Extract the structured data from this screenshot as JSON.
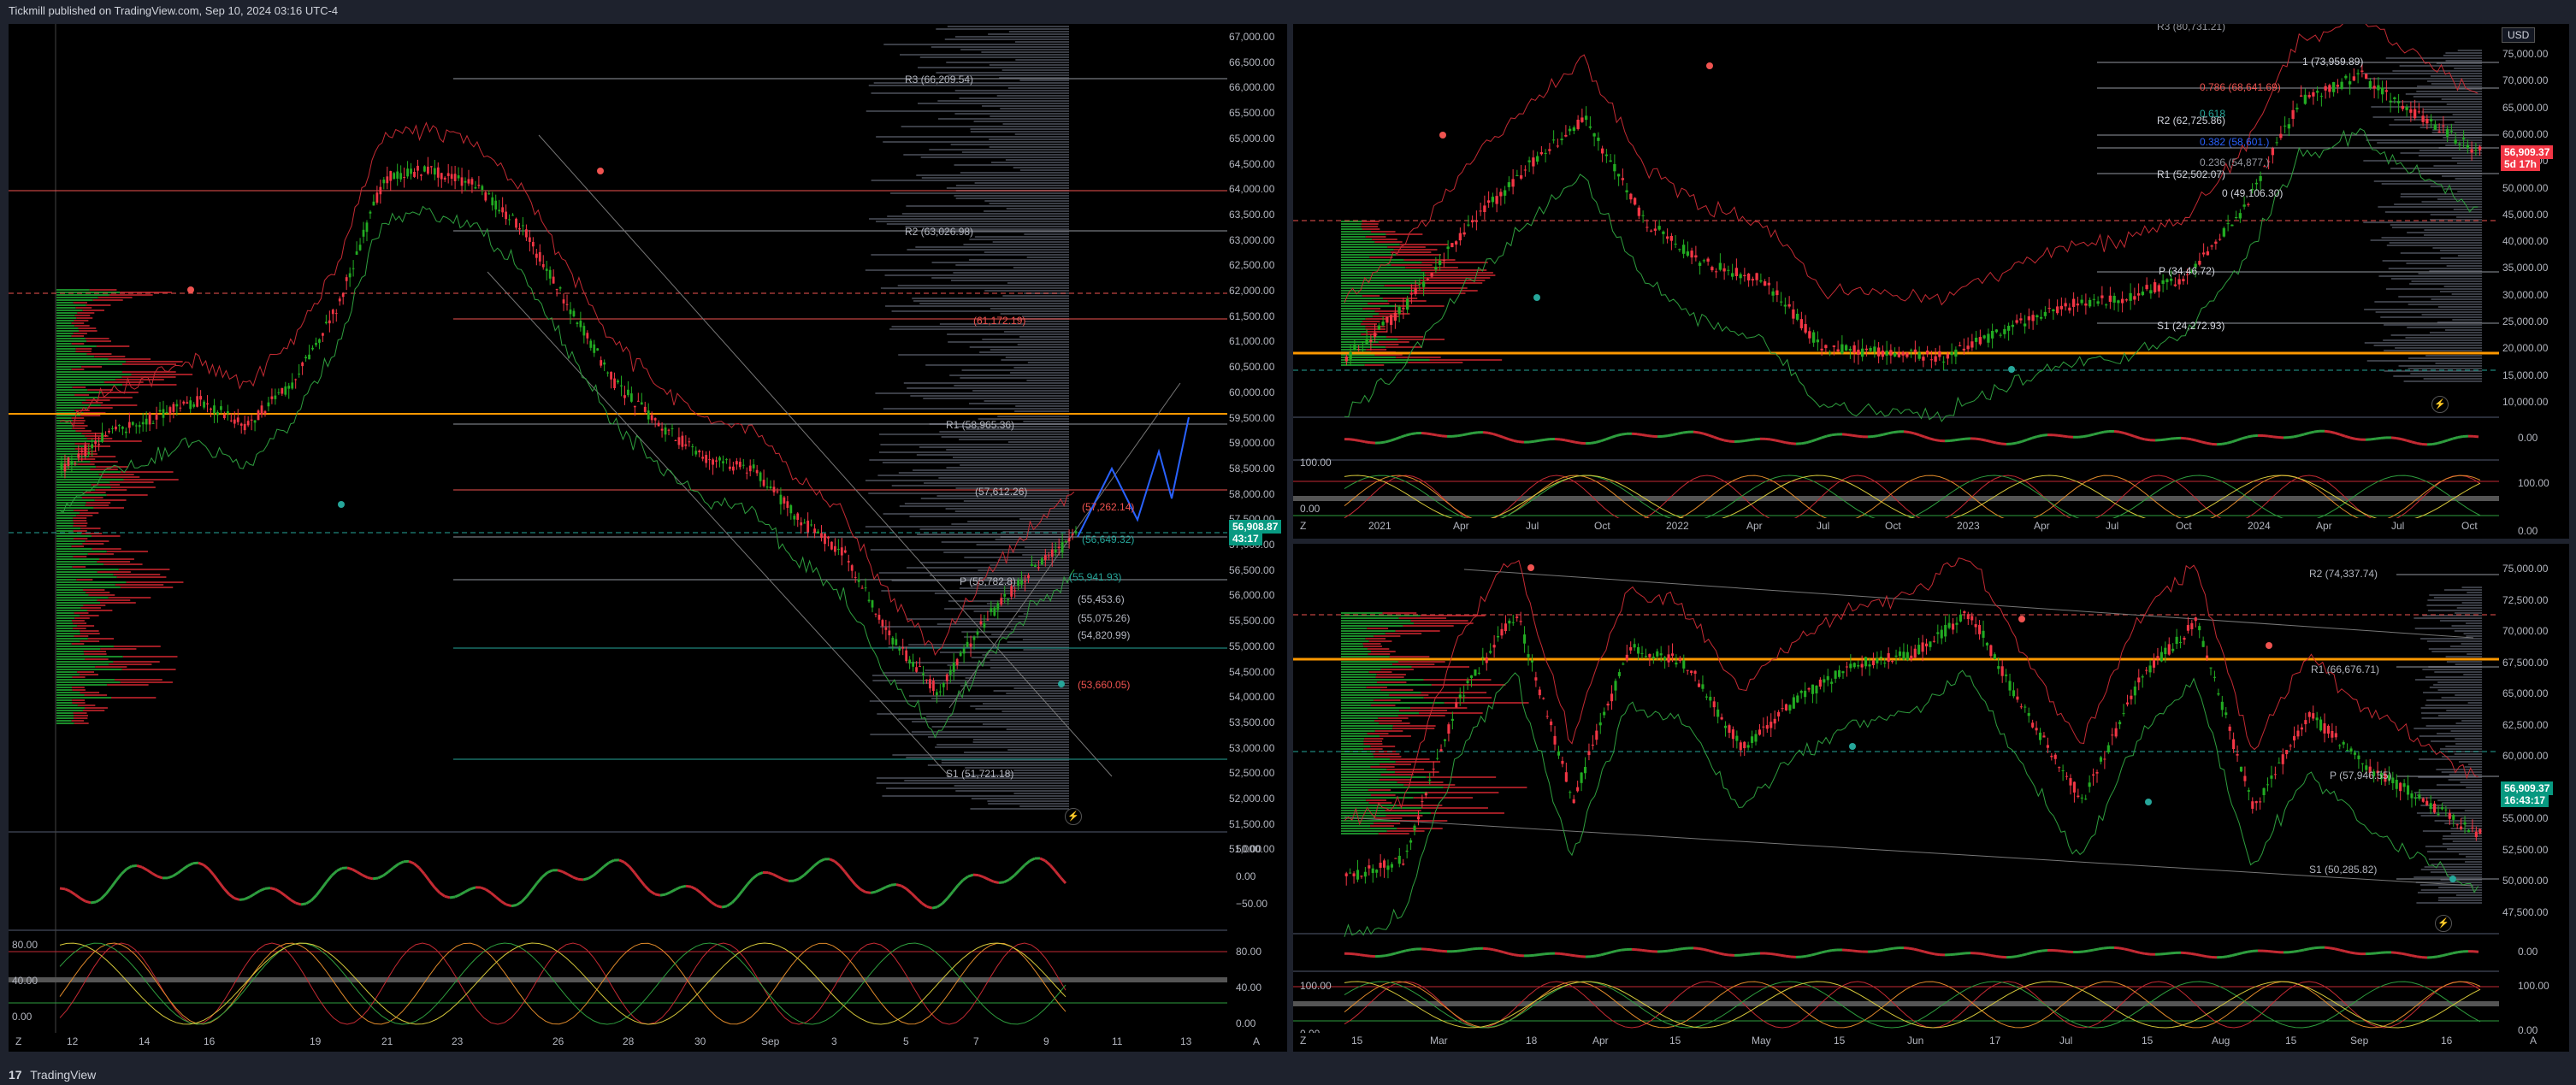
{
  "header": {
    "publisher_text": "Tickmill published on TradingView.com, Sep 10, 2024 03:16 UTC-4"
  },
  "footer": {
    "brand": "TradingView",
    "logo_glyph": "17"
  },
  "colors": {
    "bull": "#26a69a",
    "bear": "#ef5350",
    "green_candle": "#22ab22",
    "red_candle": "#f23645",
    "orange": "#ff9800"
  },
  "left_chart": {
    "price_axis": [
      "67,000.00",
      "66,500.00",
      "66,000.00",
      "65,500.00",
      "65,000.00",
      "64,500.00",
      "64,000.00",
      "63,500.00",
      "63,000.00",
      "62,500.00",
      "62,000.00",
      "61,500.00",
      "61,000.00",
      "60,500.00",
      "60,000.00",
      "59,500.00",
      "59,000.00",
      "58,500.00",
      "58,000.00",
      "57,500.00",
      "57,000.00",
      "56,500.00",
      "56,000.00",
      "55,500.00",
      "55,000.00",
      "54,500.00",
      "54,000.00",
      "53,500.00",
      "53,000.00",
      "52,500.00",
      "52,000.00",
      "51,500.00",
      "51,000.00"
    ],
    "time_axis": [
      "12",
      "14",
      "16",
      "19",
      "21",
      "23",
      "26",
      "28",
      "30",
      "Sep",
      "3",
      "5",
      "7",
      "9",
      "11",
      "13"
    ],
    "current_price": "56,908.87",
    "countdown": "43:17",
    "levels": [
      {
        "label": "R3 (66,209.54)"
      },
      {
        "label": "R2 (63,026.98)"
      },
      {
        "label": "(61,172.19)"
      },
      {
        "label": "R1 (58,965.36)"
      },
      {
        "label": "(57,612.26)"
      },
      {
        "label": "(57,262.14)"
      },
      {
        "label": "(56,649.32)"
      },
      {
        "label": "(55,941.93)"
      },
      {
        "label": "P (55,782.8)"
      },
      {
        "label": "(55,453.6)"
      },
      {
        "label": "(55,075.26)"
      },
      {
        "label": "(54,820.99)"
      },
      {
        "label": "(53,660.05)"
      },
      {
        "label": "S1 (51,721.18)"
      }
    ],
    "rsi_axis": [
      "50.00",
      "0.00",
      "−50.00"
    ],
    "stoch_axis": [
      "80.00",
      "40.00",
      "0.00"
    ],
    "stoch_axis_right": [
      "80.00",
      "40.00",
      "0.00"
    ]
  },
  "top_right_chart": {
    "currency_button": "USD",
    "price_axis": [
      "75,000.00",
      "70,000.00",
      "65,000.00",
      "60,000.00",
      "55,000.00",
      "50,000.00",
      "45,000.00",
      "40,000.00",
      "35,000.00",
      "30,000.00",
      "25,000.00",
      "20,000.00",
      "15,000.00",
      "10,000.00"
    ],
    "time_axis": [
      "2021",
      "Apr",
      "Jul",
      "Oct",
      "2022",
      "Apr",
      "Jul",
      "Oct",
      "2023",
      "Apr",
      "Jul",
      "Oct",
      "2024",
      "Apr",
      "Jul",
      "Oct"
    ],
    "current_price": "56,909.37",
    "countdown": "5d 17h",
    "levels": [
      {
        "label": "R3 (80,731.21)"
      },
      {
        "label": "1 (73,959.89)"
      },
      {
        "label": "0.786 (68,641.69)"
      },
      {
        "label": "0.618"
      },
      {
        "label": "R2 (62,725.86)"
      },
      {
        "label": "0.382 (58,601.)"
      },
      {
        "label": "0.236 (54,877.)"
      },
      {
        "label": "R1 (52,502.07)"
      },
      {
        "label": "0 (49,106.30)"
      },
      {
        "label": "P (34,46.72)"
      },
      {
        "label": "S1 (24,272.93)"
      }
    ],
    "osc_axis": [
      "0.00"
    ],
    "stoch_axis": [
      "100.00",
      "0.00"
    ]
  },
  "bottom_right_chart": {
    "price_axis": [
      "75,000.00",
      "72,500.00",
      "70,000.00",
      "67,500.00",
      "65,000.00",
      "62,500.00",
      "60,000.00",
      "57,500.00",
      "55,000.00",
      "52,500.00",
      "50,000.00",
      "47,500.00"
    ],
    "time_axis": [
      "15",
      "Mar",
      "18",
      "Apr",
      "15",
      "May",
      "15",
      "Jun",
      "17",
      "Jul",
      "15",
      "Aug",
      "15",
      "Sep",
      "16"
    ],
    "current_price": "56,909.37",
    "countdown": "16:43:17",
    "levels": [
      {
        "label": "R2 (74,337.74)"
      },
      {
        "label": "R1 (66,676.71)"
      },
      {
        "label": "P (57,946.55)"
      },
      {
        "label": "S1 (50,285.82)"
      }
    ],
    "osc_axis": [
      "0.00"
    ],
    "stoch_axis": [
      "100.00",
      "0.00"
    ]
  },
  "corner": {
    "left": "Z",
    "right": "A"
  }
}
